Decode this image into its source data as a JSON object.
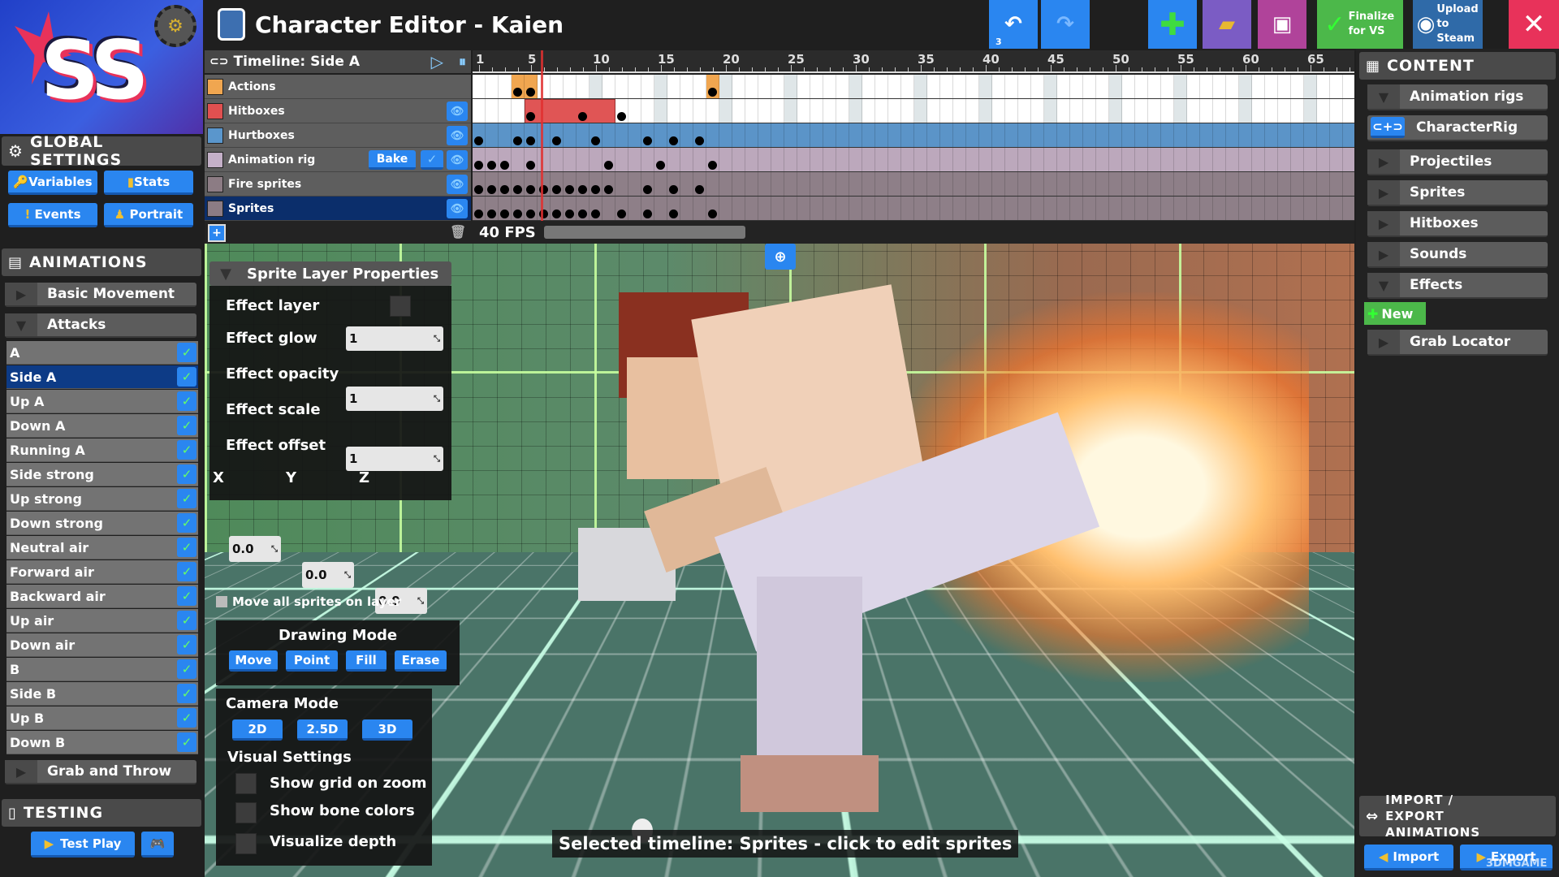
{
  "app": {
    "title": "Character Editor - Kaien",
    "logo_text": "SS"
  },
  "toolbar": {
    "undo_count": "3",
    "finalize_label": "Finalize for VS",
    "upload_label": "Upload to Steam",
    "colors": {
      "undo": "#2a86f0",
      "add": "#2a86f0",
      "open": "#7b5cc4",
      "save": "#b0439a",
      "finalize": "#4cb84a",
      "upload": "#2f6aa8",
      "close": "#e8325a"
    }
  },
  "global_settings": {
    "title": "GLOBAL SETTINGS",
    "buttons": [
      "Variables",
      "Stats",
      "Events",
      "Portrait"
    ]
  },
  "animations": {
    "title": "ANIMATIONS",
    "groups": [
      "Basic Movement",
      "Attacks",
      "Grab and Throw"
    ],
    "items": [
      "A",
      "Side A",
      "Up A",
      "Down A",
      "Running A",
      "Side strong",
      "Up strong",
      "Down strong",
      "Neutral air",
      "Forward air",
      "Backward air",
      "Up air",
      "Down air",
      "B",
      "Side B",
      "Up B",
      "Down B"
    ],
    "selected": "Side A"
  },
  "testing": {
    "title": "TESTING",
    "test_play": "Test Play"
  },
  "timeline": {
    "title": "Timeline: Side A",
    "fps": "40 FPS",
    "bake_label": "Bake",
    "playhead_frame": 6,
    "ticks": [
      "1",
      "5",
      "10",
      "15",
      "20",
      "25",
      "30",
      "35",
      "40",
      "45",
      "50",
      "55",
      "60",
      "65"
    ],
    "layers": [
      {
        "name": "Actions",
        "color": "#f0a650",
        "lane": "#ffffff",
        "keys": [
          4,
          5,
          19
        ],
        "eye": false
      },
      {
        "name": "Hitboxes",
        "color": "#e05050",
        "lane": "#ffffff",
        "keys": [
          5,
          9,
          12
        ],
        "bar": [
          5,
          11
        ],
        "eye": true
      },
      {
        "name": "Hurtboxes",
        "color": "#5a96cc",
        "lane": "#5b94c8",
        "keys": [
          1,
          4,
          5,
          7,
          10,
          14,
          16,
          18
        ],
        "eye": true
      },
      {
        "name": "Animation rig",
        "color": "#c4b0c8",
        "lane": "#bca8bc",
        "keys": [
          1,
          2,
          3,
          5,
          11,
          15,
          19
        ],
        "eye": true,
        "bake": true
      },
      {
        "name": "Fire sprites",
        "color": "#8c7c84",
        "lane": "#8e7f88",
        "keys": [
          1,
          2,
          3,
          4,
          5,
          6,
          7,
          8,
          9,
          10,
          11,
          14,
          16,
          18
        ],
        "eye": true
      },
      {
        "name": "Sprites",
        "color": "#8c7c84",
        "lane": "#8e7f88",
        "keys": [
          1,
          2,
          3,
          4,
          5,
          6,
          7,
          8,
          9,
          10,
          12,
          14,
          16,
          19
        ],
        "eye": true,
        "selected": true
      }
    ]
  },
  "content": {
    "title": "CONTENT",
    "items": [
      "Animation rigs",
      "CharacterRig",
      "Projectiles",
      "Sprites",
      "Hitboxes",
      "Sounds",
      "Effects",
      "New",
      "Grab Locator"
    ],
    "import_export_title": "IMPORT / EXPORT ANIMATIONS",
    "import_label": "Import",
    "export_label": "Export"
  },
  "sprite_props": {
    "title": "Sprite Layer Properties",
    "effect_layer": "Effect layer",
    "effect_glow": "Effect glow",
    "glow_value": "1",
    "effect_opacity": "Effect opacity",
    "opacity_value": "1",
    "effect_scale": "Effect scale",
    "scale_value": "1",
    "effect_offset": "Effect offset",
    "x_label": "X",
    "y_label": "Y",
    "z_label": "Z",
    "x": "0.0",
    "y": "0.0",
    "z": "0.0",
    "move_all": "Move all sprites on layer"
  },
  "drawing_mode": {
    "title": "Drawing Mode",
    "buttons": [
      "Move",
      "Point",
      "Fill",
      "Erase"
    ]
  },
  "camera_mode": {
    "title": "Camera Mode",
    "buttons": [
      "2D",
      "2.5D",
      "3D"
    ]
  },
  "visual_settings": {
    "title": "Visual Settings",
    "options": [
      "Show grid on zoom",
      "Show bone colors",
      "Visualize depth"
    ]
  },
  "status": {
    "text": "Selected timeline: Sprites - click to edit sprites"
  },
  "watermark": "3DMGAME"
}
